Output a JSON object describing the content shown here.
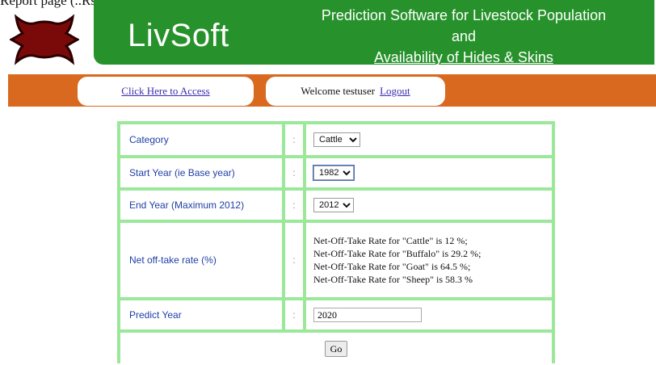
{
  "page": {
    "cut_caption": "Report page (..Rs. ..)"
  },
  "header": {
    "app_name": "LivSoft",
    "tagline_lines": [
      "Prediction Software for Livestock Population",
      "and",
      "Availability of Hides & Skins"
    ],
    "logo_icon": "leather-hide-icon",
    "colors": {
      "banner": "#27922b",
      "nav_bar": "#d8691f",
      "logo": "#7a0a0a"
    }
  },
  "nav": {
    "access_link": "Click Here to Access",
    "welcome_text": "Welcome testuser",
    "logout_link": "Logout"
  },
  "form": {
    "colon": ":",
    "rows": [
      {
        "label": "Category",
        "value": "Cattle",
        "options": [
          "Cattle"
        ]
      },
      {
        "label": "Start Year (ie Base year)",
        "value": "1982",
        "options": [
          "1982"
        ]
      },
      {
        "label": "End Year (Maximum 2012)",
        "value": "2012",
        "options": [
          "2012"
        ]
      },
      {
        "label": "Net off-take rate (%)",
        "rates": [
          "Net-Off-Take Rate for \"Cattle\" is 12 %;",
          "Net-Off-Take Rate for \"Buffalo\" is 29.2 %;",
          "Net-Off-Take Rate for \"Goat\" is 64.5 %;",
          "Net-Off-Take Rate for \"Sheep\" is 58.3 %"
        ]
      },
      {
        "label": "Predict Year",
        "value": "2020"
      }
    ],
    "go_label": "Go"
  }
}
